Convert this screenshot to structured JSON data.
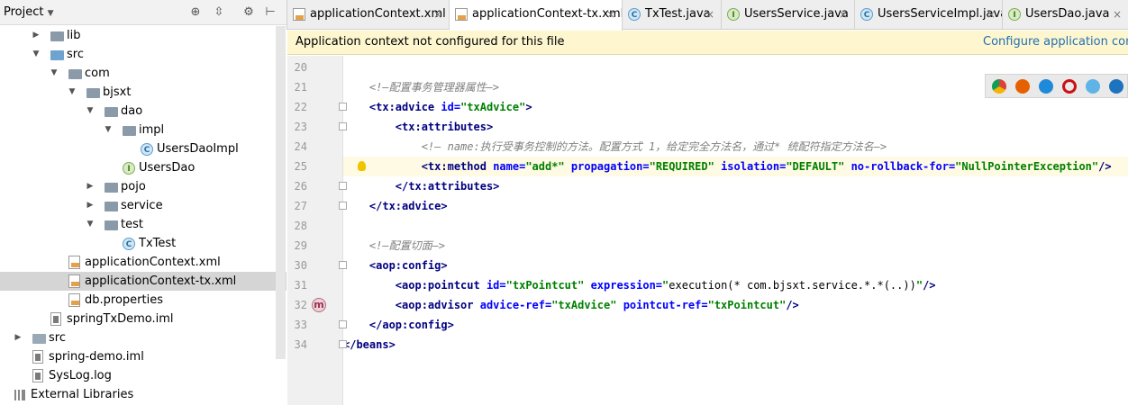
{
  "sidebar": {
    "title": "Project",
    "dropdown_icon": "chevron-down-icon",
    "toolbar_icons": [
      "crosshair-icon",
      "collapse-icon",
      "gear-icon",
      "hide-icon"
    ],
    "items": [
      {
        "label": "lib",
        "indent": 1,
        "arrow": "right",
        "icon": "folder"
      },
      {
        "label": "src",
        "indent": 1,
        "arrow": "down",
        "icon": "folder-blue"
      },
      {
        "label": "com",
        "indent": 2,
        "arrow": "down",
        "icon": "folder"
      },
      {
        "label": "bjsxt",
        "indent": 3,
        "arrow": "down",
        "icon": "folder"
      },
      {
        "label": "dao",
        "indent": 4,
        "arrow": "down",
        "icon": "folder"
      },
      {
        "label": "impl",
        "indent": 5,
        "arrow": "down",
        "icon": "folder"
      },
      {
        "label": "UsersDaoImpl",
        "indent": 6,
        "arrow": "",
        "icon": "class"
      },
      {
        "label": "UsersDao",
        "indent": 5,
        "arrow": "",
        "icon": "interface"
      },
      {
        "label": "pojo",
        "indent": 4,
        "arrow": "right",
        "icon": "folder"
      },
      {
        "label": "service",
        "indent": 4,
        "arrow": "right",
        "icon": "folder"
      },
      {
        "label": "test",
        "indent": 4,
        "arrow": "down",
        "icon": "folder"
      },
      {
        "label": "TxTest",
        "indent": 5,
        "arrow": "",
        "icon": "class"
      },
      {
        "label": "applicationContext.xml",
        "indent": 2,
        "arrow": "",
        "icon": "xml"
      },
      {
        "label": "applicationContext-tx.xml",
        "indent": 2,
        "arrow": "",
        "icon": "xml",
        "selected": true
      },
      {
        "label": "db.properties",
        "indent": 2,
        "arrow": "",
        "icon": "xml"
      },
      {
        "label": "springTxDemo.iml",
        "indent": 1,
        "arrow": "",
        "icon": "file"
      },
      {
        "label": "src",
        "indent": 0,
        "arrow": "right",
        "icon": "folder-light"
      },
      {
        "label": "spring-demo.iml",
        "indent": 0,
        "arrow": "",
        "icon": "file"
      },
      {
        "label": "SysLog.log",
        "indent": 0,
        "arrow": "",
        "icon": "file"
      },
      {
        "label": "External Libraries",
        "indent": -1,
        "arrow": "",
        "icon": "libs"
      }
    ]
  },
  "tabs": [
    {
      "label": "applicationContext.xml",
      "icon": "xml"
    },
    {
      "label": "applicationContext-tx.xml",
      "icon": "xml",
      "active": true
    },
    {
      "label": "TxTest.java",
      "icon": "class"
    },
    {
      "label": "UsersService.java",
      "icon": "interface"
    },
    {
      "label": "UsersServiceImpl.java",
      "icon": "class"
    },
    {
      "label": "UsersDao.java",
      "icon": "interface"
    }
  ],
  "banner": {
    "message": "Application context not configured for this file",
    "link": "Configure application context"
  },
  "browser_icons": [
    "chrome-icon",
    "firefox-icon",
    "safari-icon",
    "opera-icon",
    "ie-icon",
    "edge-icon"
  ],
  "browser_colors": [
    "#dd4b39",
    "#e66000",
    "#1f8ad9",
    "#cc0f16",
    "#5fb3e6",
    "#1e73be"
  ],
  "editor": {
    "lines": [
      {
        "n": "20",
        "segs": []
      },
      {
        "n": "21",
        "segs": [
          {
            "t": "    <!—配置事务管理器属性—>",
            "c": "cmt"
          }
        ]
      },
      {
        "n": "22",
        "fold": true,
        "segs": [
          {
            "t": "    ",
            "c": "txt"
          },
          {
            "t": "<tx:advice ",
            "c": "tag"
          },
          {
            "t": "id=",
            "c": "attr"
          },
          {
            "t": "\"txAdvice\"",
            "c": "val"
          },
          {
            "t": ">",
            "c": "tag"
          }
        ]
      },
      {
        "n": "23",
        "fold": true,
        "segs": [
          {
            "t": "        ",
            "c": "txt"
          },
          {
            "t": "<tx:attributes>",
            "c": "tag"
          }
        ]
      },
      {
        "n": "24",
        "segs": [
          {
            "t": "            <!— name:执行受事务控制的方法。配置方式 1，给定完全方法名，通过* 统配符指定方法名—>",
            "c": "cmt"
          }
        ]
      },
      {
        "n": "25",
        "hl": true,
        "bulb": true,
        "segs": [
          {
            "t": "            ",
            "c": "txt"
          },
          {
            "t": "<tx:method ",
            "c": "tag"
          },
          {
            "t": "name=",
            "c": "attr"
          },
          {
            "t": "\"add*\" ",
            "c": "val"
          },
          {
            "t": "propagation=",
            "c": "attr"
          },
          {
            "t": "\"REQUIRED\" ",
            "c": "val"
          },
          {
            "t": "isolation=",
            "c": "attr"
          },
          {
            "t": "\"DEFAULT\" ",
            "c": "val"
          },
          {
            "t": "no-rollback-for=",
            "c": "attr"
          },
          {
            "t": "\"NullPointerException\"",
            "c": "val"
          },
          {
            "t": "/>",
            "c": "tag"
          }
        ]
      },
      {
        "n": "26",
        "fold": true,
        "segs": [
          {
            "t": "        ",
            "c": "txt"
          },
          {
            "t": "</tx:attributes>",
            "c": "tag"
          }
        ]
      },
      {
        "n": "27",
        "fold": true,
        "segs": [
          {
            "t": "    ",
            "c": "txt"
          },
          {
            "t": "</tx:advice>",
            "c": "tag"
          }
        ]
      },
      {
        "n": "28",
        "segs": []
      },
      {
        "n": "29",
        "segs": [
          {
            "t": "    <!—配置切面—>",
            "c": "cmt"
          }
        ]
      },
      {
        "n": "30",
        "fold": true,
        "segs": [
          {
            "t": "    ",
            "c": "txt"
          },
          {
            "t": "<aop:config>",
            "c": "tag"
          }
        ]
      },
      {
        "n": "31",
        "segs": [
          {
            "t": "        ",
            "c": "txt"
          },
          {
            "t": "<aop:pointcut ",
            "c": "tag"
          },
          {
            "t": "id=",
            "c": "attr"
          },
          {
            "t": "\"txPointcut\" ",
            "c": "val"
          },
          {
            "t": "expression=",
            "c": "attr"
          },
          {
            "t": "\"",
            "c": "val"
          },
          {
            "t": "execution(* com.bjsxt.service.*.*(..))",
            "c": "txt"
          },
          {
            "t": "\"",
            "c": "val"
          },
          {
            "t": "/>",
            "c": "tag"
          }
        ]
      },
      {
        "n": "32",
        "mark": true,
        "segs": [
          {
            "t": "        ",
            "c": "txt"
          },
          {
            "t": "<aop:advisor ",
            "c": "tag"
          },
          {
            "t": "advice-ref=",
            "c": "attr"
          },
          {
            "t": "\"txAdvice\" ",
            "c": "val"
          },
          {
            "t": "pointcut-ref=",
            "c": "attr"
          },
          {
            "t": "\"txPointcut\"",
            "c": "val"
          },
          {
            "t": "/>",
            "c": "tag"
          }
        ]
      },
      {
        "n": "33",
        "fold": true,
        "segs": [
          {
            "t": "    ",
            "c": "txt"
          },
          {
            "t": "</aop:config>",
            "c": "tag"
          }
        ]
      },
      {
        "n": "34",
        "fold": true,
        "segs": [
          {
            "t": "</beans>",
            "c": "tag"
          }
        ]
      }
    ]
  }
}
